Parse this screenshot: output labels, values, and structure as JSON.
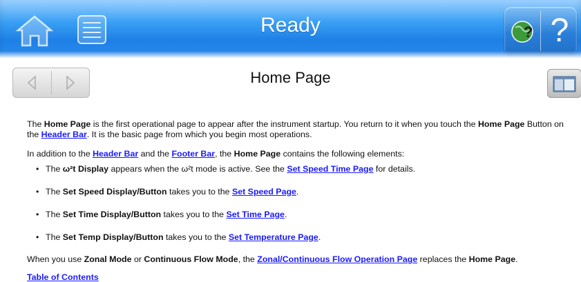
{
  "header": {
    "title": "Ready",
    "icons": [
      "home-icon",
      "list-icon",
      "globe-help-icon",
      "question-icon"
    ],
    "question_glyph": "?"
  },
  "nav": {
    "page_heading": "Home Page",
    "icons": [
      "back-arrow-icon",
      "forward-arrow-icon",
      "window-icon"
    ]
  },
  "content": {
    "p1": {
      "t1": "The ",
      "b1": "Home Page",
      "t2": " is the first operational page to appear after the instrument startup. You return to it when you touch the ",
      "b2": "Home Page",
      "t3": " Button on the ",
      "link1": "Header Bar",
      "t4": ". It is the basic page from which you begin most operations."
    },
    "p2": {
      "t1": "In addition to the ",
      "link1": "Header Bar",
      "t2": " and the ",
      "link2": "Footer Bar",
      "t3": ", the ",
      "b1": "Home Page",
      "t4": " contains the following elements:"
    },
    "bullets": [
      {
        "t1": "The ",
        "b1": "ω²t Display",
        "t2": " appears when the ω²t mode is active. See the ",
        "link": "Set Speed Time Page",
        "t3": " for details."
      },
      {
        "t1": "The ",
        "b1": "Set Speed Display/Button",
        "t2": " takes you to the ",
        "link": "Set Speed Page",
        "t3": "."
      },
      {
        "t1": "The ",
        "b1": "Set Time Display/Button",
        "t2": " takes you to the ",
        "link": "Set Time Page",
        "t3": "."
      },
      {
        "t1": "The ",
        "b1": "Set Temp Display/Button",
        "t2": " takes you to the ",
        "link": "Set Temperature Page",
        "t3": "."
      }
    ],
    "p3": {
      "t1": "When you use ",
      "b1": "Zonal Mode",
      "t2": " or ",
      "b2": "Continuous Flow Mode",
      "t3": ", the ",
      "link": "Zonal/Continuous Flow Operation Page",
      "t4": " replaces the ",
      "b3": "Home Page",
      "t5": "."
    },
    "toc_link": "Table of Contents",
    "bullet_glyph": "•"
  },
  "colors": {
    "header_blue": "#2b8ef0",
    "link_blue": "#1a1aff"
  }
}
